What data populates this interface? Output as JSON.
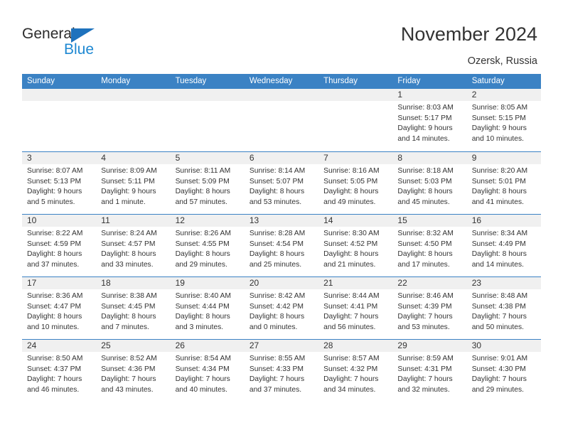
{
  "brand": {
    "name_part1": "General",
    "name_part2": "Blue",
    "triangle_color": "#1e72bd",
    "blue_color": "#1e88d2"
  },
  "header": {
    "title": "November 2024",
    "subtitle": "Ozersk, Russia"
  },
  "theme": {
    "header_blue": "#3b82c4",
    "daynum_band": "#f0f0f0",
    "text": "#333333"
  },
  "weekdays": [
    "Sunday",
    "Monday",
    "Tuesday",
    "Wednesday",
    "Thursday",
    "Friday",
    "Saturday"
  ],
  "weeks": [
    [
      {
        "day": "",
        "lines": []
      },
      {
        "day": "",
        "lines": []
      },
      {
        "day": "",
        "lines": []
      },
      {
        "day": "",
        "lines": []
      },
      {
        "day": "",
        "lines": []
      },
      {
        "day": "1",
        "lines": [
          "Sunrise: 8:03 AM",
          "Sunset: 5:17 PM",
          "Daylight: 9 hours",
          "and 14 minutes."
        ]
      },
      {
        "day": "2",
        "lines": [
          "Sunrise: 8:05 AM",
          "Sunset: 5:15 PM",
          "Daylight: 9 hours",
          "and 10 minutes."
        ]
      }
    ],
    [
      {
        "day": "3",
        "lines": [
          "Sunrise: 8:07 AM",
          "Sunset: 5:13 PM",
          "Daylight: 9 hours",
          "and 5 minutes."
        ]
      },
      {
        "day": "4",
        "lines": [
          "Sunrise: 8:09 AM",
          "Sunset: 5:11 PM",
          "Daylight: 9 hours",
          "and 1 minute."
        ]
      },
      {
        "day": "5",
        "lines": [
          "Sunrise: 8:11 AM",
          "Sunset: 5:09 PM",
          "Daylight: 8 hours",
          "and 57 minutes."
        ]
      },
      {
        "day": "6",
        "lines": [
          "Sunrise: 8:14 AM",
          "Sunset: 5:07 PM",
          "Daylight: 8 hours",
          "and 53 minutes."
        ]
      },
      {
        "day": "7",
        "lines": [
          "Sunrise: 8:16 AM",
          "Sunset: 5:05 PM",
          "Daylight: 8 hours",
          "and 49 minutes."
        ]
      },
      {
        "day": "8",
        "lines": [
          "Sunrise: 8:18 AM",
          "Sunset: 5:03 PM",
          "Daylight: 8 hours",
          "and 45 minutes."
        ]
      },
      {
        "day": "9",
        "lines": [
          "Sunrise: 8:20 AM",
          "Sunset: 5:01 PM",
          "Daylight: 8 hours",
          "and 41 minutes."
        ]
      }
    ],
    [
      {
        "day": "10",
        "lines": [
          "Sunrise: 8:22 AM",
          "Sunset: 4:59 PM",
          "Daylight: 8 hours",
          "and 37 minutes."
        ]
      },
      {
        "day": "11",
        "lines": [
          "Sunrise: 8:24 AM",
          "Sunset: 4:57 PM",
          "Daylight: 8 hours",
          "and 33 minutes."
        ]
      },
      {
        "day": "12",
        "lines": [
          "Sunrise: 8:26 AM",
          "Sunset: 4:55 PM",
          "Daylight: 8 hours",
          "and 29 minutes."
        ]
      },
      {
        "day": "13",
        "lines": [
          "Sunrise: 8:28 AM",
          "Sunset: 4:54 PM",
          "Daylight: 8 hours",
          "and 25 minutes."
        ]
      },
      {
        "day": "14",
        "lines": [
          "Sunrise: 8:30 AM",
          "Sunset: 4:52 PM",
          "Daylight: 8 hours",
          "and 21 minutes."
        ]
      },
      {
        "day": "15",
        "lines": [
          "Sunrise: 8:32 AM",
          "Sunset: 4:50 PM",
          "Daylight: 8 hours",
          "and 17 minutes."
        ]
      },
      {
        "day": "16",
        "lines": [
          "Sunrise: 8:34 AM",
          "Sunset: 4:49 PM",
          "Daylight: 8 hours",
          "and 14 minutes."
        ]
      }
    ],
    [
      {
        "day": "17",
        "lines": [
          "Sunrise: 8:36 AM",
          "Sunset: 4:47 PM",
          "Daylight: 8 hours",
          "and 10 minutes."
        ]
      },
      {
        "day": "18",
        "lines": [
          "Sunrise: 8:38 AM",
          "Sunset: 4:45 PM",
          "Daylight: 8 hours",
          "and 7 minutes."
        ]
      },
      {
        "day": "19",
        "lines": [
          "Sunrise: 8:40 AM",
          "Sunset: 4:44 PM",
          "Daylight: 8 hours",
          "and 3 minutes."
        ]
      },
      {
        "day": "20",
        "lines": [
          "Sunrise: 8:42 AM",
          "Sunset: 4:42 PM",
          "Daylight: 8 hours",
          "and 0 minutes."
        ]
      },
      {
        "day": "21",
        "lines": [
          "Sunrise: 8:44 AM",
          "Sunset: 4:41 PM",
          "Daylight: 7 hours",
          "and 56 minutes."
        ]
      },
      {
        "day": "22",
        "lines": [
          "Sunrise: 8:46 AM",
          "Sunset: 4:39 PM",
          "Daylight: 7 hours",
          "and 53 minutes."
        ]
      },
      {
        "day": "23",
        "lines": [
          "Sunrise: 8:48 AM",
          "Sunset: 4:38 PM",
          "Daylight: 7 hours",
          "and 50 minutes."
        ]
      }
    ],
    [
      {
        "day": "24",
        "lines": [
          "Sunrise: 8:50 AM",
          "Sunset: 4:37 PM",
          "Daylight: 7 hours",
          "and 46 minutes."
        ]
      },
      {
        "day": "25",
        "lines": [
          "Sunrise: 8:52 AM",
          "Sunset: 4:36 PM",
          "Daylight: 7 hours",
          "and 43 minutes."
        ]
      },
      {
        "day": "26",
        "lines": [
          "Sunrise: 8:54 AM",
          "Sunset: 4:34 PM",
          "Daylight: 7 hours",
          "and 40 minutes."
        ]
      },
      {
        "day": "27",
        "lines": [
          "Sunrise: 8:55 AM",
          "Sunset: 4:33 PM",
          "Daylight: 7 hours",
          "and 37 minutes."
        ]
      },
      {
        "day": "28",
        "lines": [
          "Sunrise: 8:57 AM",
          "Sunset: 4:32 PM",
          "Daylight: 7 hours",
          "and 34 minutes."
        ]
      },
      {
        "day": "29",
        "lines": [
          "Sunrise: 8:59 AM",
          "Sunset: 4:31 PM",
          "Daylight: 7 hours",
          "and 32 minutes."
        ]
      },
      {
        "day": "30",
        "lines": [
          "Sunrise: 9:01 AM",
          "Sunset: 4:30 PM",
          "Daylight: 7 hours",
          "and 29 minutes."
        ]
      }
    ]
  ]
}
